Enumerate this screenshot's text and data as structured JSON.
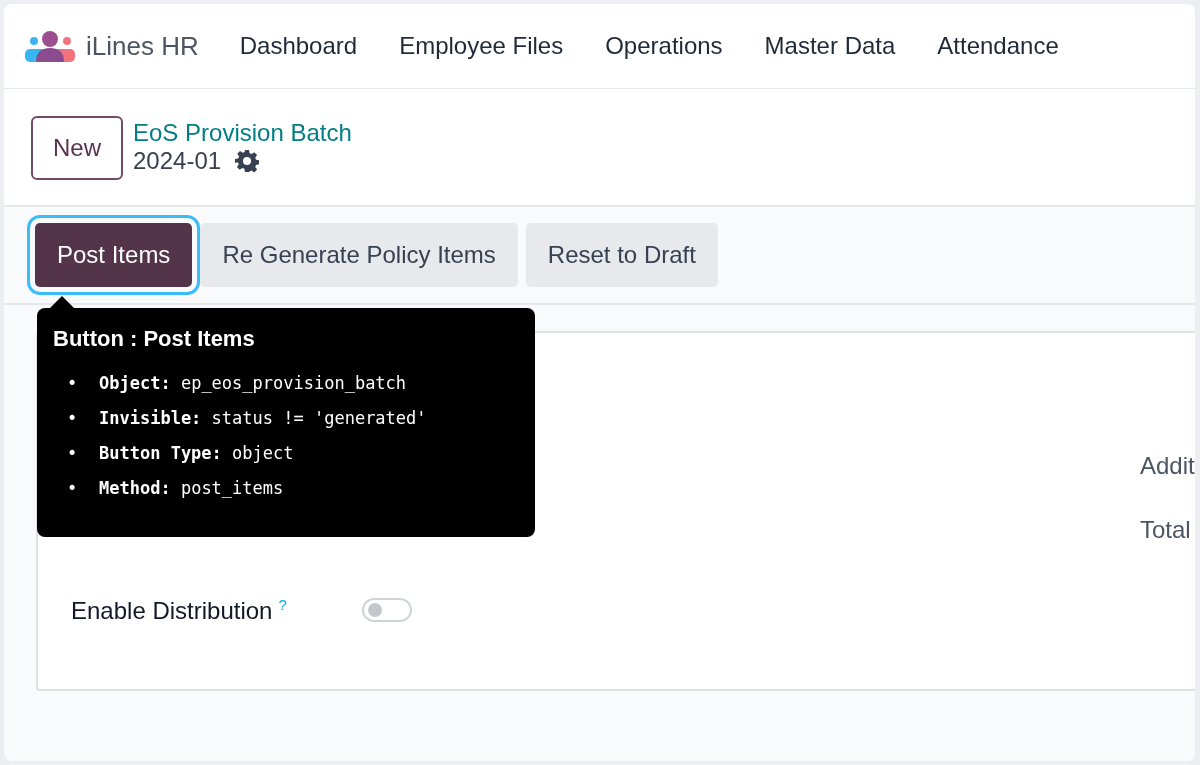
{
  "app": {
    "name": "iLines HR"
  },
  "menu": [
    {
      "label": "Dashboard"
    },
    {
      "label": "Employee Files"
    },
    {
      "label": "Operations"
    },
    {
      "label": "Master Data"
    },
    {
      "label": "Attendance"
    }
  ],
  "breadcrumb": {
    "new_button": "New",
    "parent": "EoS Provision Batch",
    "record": "2024-01"
  },
  "buttons": [
    {
      "label": "Post Items",
      "kind": "primary",
      "focused": true
    },
    {
      "label": "Re Generate Policy Items",
      "kind": "secondary",
      "focused": false
    },
    {
      "label": "Reset to Draft",
      "kind": "secondary",
      "focused": false
    }
  ],
  "form": {
    "left_fields": [
      {
        "label": "Enable Distribution",
        "kind": "toggle",
        "help": "?",
        "on": false
      }
    ],
    "right_fields": [
      {
        "label": "Addit"
      },
      {
        "label": "Total"
      }
    ]
  },
  "tooltip": {
    "title": "Button : Post Items",
    "items": [
      {
        "marker": "•",
        "key": "Object:",
        "value": "ep_eos_provision_batch"
      },
      {
        "marker": "•",
        "key": "Invisible:",
        "value": "status != 'generated'"
      },
      {
        "marker": "•",
        "key": "Button Type:",
        "value": "object"
      },
      {
        "marker": "•",
        "key": "Method:",
        "value": "post_items"
      }
    ]
  }
}
